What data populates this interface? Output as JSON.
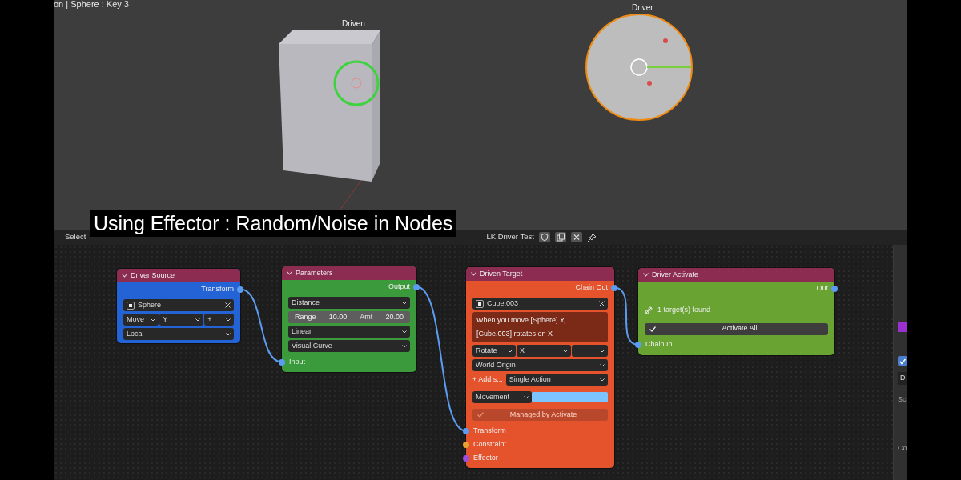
{
  "viewport": {
    "header": "on | Sphere : Key 3",
    "objects": [
      {
        "label": "Driven",
        "kind": "cube",
        "selected": false
      },
      {
        "label": "Driver",
        "kind": "sphere",
        "selected": true
      }
    ]
  },
  "caption": "Using Effector : Random/Noise in Nodes",
  "editor_header": {
    "menu": [
      "Select"
    ],
    "tree_name": "LK Driver Test"
  },
  "nodes": [
    {
      "title": "Driver Source",
      "color": "#2463d6",
      "outputs": [
        {
          "label": "Transform",
          "color": "#5b9cf0"
        }
      ],
      "rows": [
        {
          "kind": "object",
          "value": "Sphere"
        },
        {
          "kind": "dropdowns",
          "items": [
            "Move",
            "Y",
            "+"
          ]
        },
        {
          "kind": "dropdown",
          "value": "Local"
        }
      ]
    },
    {
      "title": "Parameters",
      "color": "#3b9a3b",
      "outputs": [
        {
          "label": "Output",
          "color": "#5b9cf0"
        }
      ],
      "rows": [
        {
          "kind": "dropdown",
          "value": "Distance"
        },
        {
          "kind": "range",
          "items": [
            "Range",
            "10.00",
            "Amt",
            "20.00"
          ]
        },
        {
          "kind": "dropdown",
          "value": "Linear"
        },
        {
          "kind": "dropdown",
          "value": "Visual Curve"
        }
      ],
      "inputs": [
        {
          "label": "Input",
          "color": "#5b9cf0"
        }
      ]
    },
    {
      "title": "Driven Target",
      "color": "#e4532b",
      "outputs": [
        {
          "label": "Chain Out",
          "color": "#5b9cf0"
        }
      ],
      "rows": [
        {
          "kind": "object",
          "value": "Cube.003"
        },
        {
          "kind": "info",
          "lines": [
            "When you move [Sphere] Y,",
            "[Cube.003] rotates on X"
          ]
        },
        {
          "kind": "dropdowns",
          "items": [
            "Rotate",
            "X",
            "+"
          ]
        },
        {
          "kind": "dropdown",
          "value": "World Origin"
        },
        {
          "kind": "add",
          "label": "+ Add s...",
          "value": "Single Action"
        },
        {
          "kind": "color",
          "value": "Movement",
          "color": "#7cc4ff"
        },
        {
          "kind": "button",
          "label": "Managed by Activate",
          "disabled": true
        }
      ],
      "inputs": [
        {
          "label": "Transform",
          "color": "#5b9cf0"
        },
        {
          "label": "Constraint",
          "color": "#e8a030"
        },
        {
          "label": "Effector",
          "color": "#9a4de0"
        }
      ]
    },
    {
      "title": "Driver Activate",
      "color": "#69a332",
      "outputs": [
        {
          "label": "Out",
          "color": "#5b9cf0"
        }
      ],
      "rows": [
        {
          "kind": "status",
          "value": "1 target(s) found"
        },
        {
          "kind": "button",
          "label": "Activate All",
          "disabled": false
        }
      ],
      "inputs": [
        {
          "label": "Chain In",
          "color": "#5b9cf0"
        }
      ]
    }
  ],
  "sidebar": [
    {
      "kind": "swatch",
      "color": "#9b30d0"
    },
    {
      "kind": "checkbox",
      "checked": true
    },
    {
      "kind": "field",
      "text": "D"
    },
    {
      "kind": "label",
      "text": "Sc"
    },
    {
      "kind": "label",
      "text": "Co"
    }
  ]
}
